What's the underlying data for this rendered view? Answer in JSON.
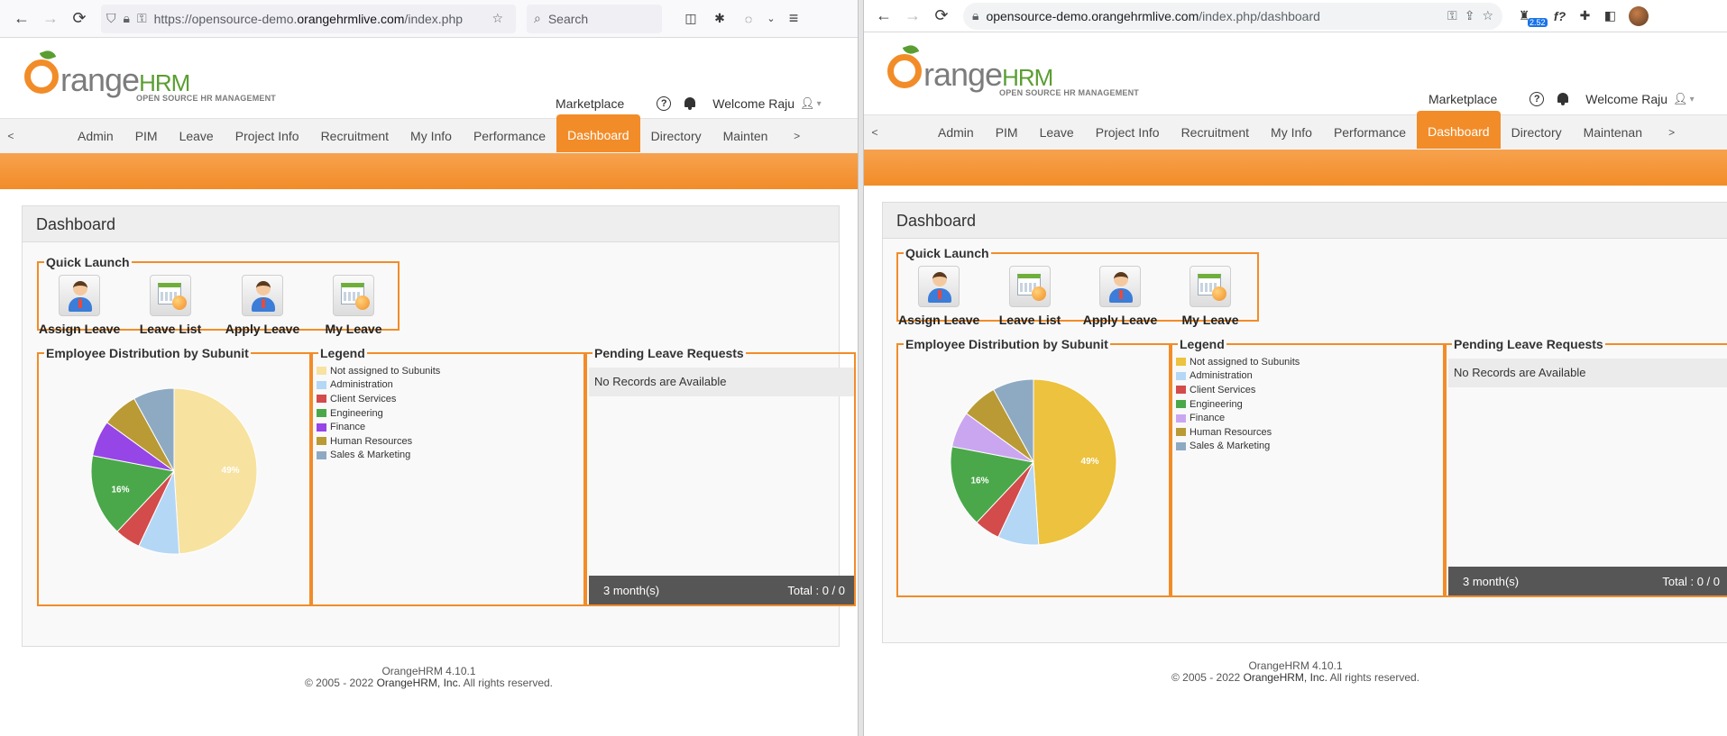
{
  "left_browser": {
    "url_prefix": "https://opensource-demo.",
    "url_host": "orangehrmlive.com",
    "url_suffix": "/index.php",
    "search_placeholder": "Search"
  },
  "right_browser": {
    "url_host": "opensource-demo.orangehrmlive.com",
    "url_path": "/index.php/dashboard",
    "extension_badge": "2.52",
    "formula_label": "f?"
  },
  "brand": {
    "logo_word": "range",
    "logo_hrm": "HRM",
    "tagline": "OPEN SOURCE HR MANAGEMENT",
    "orange": "#f28c28",
    "green": "#5a9e32"
  },
  "header": {
    "marketplace": "Marketplace",
    "help": "?",
    "welcome": "Welcome Raju"
  },
  "nav": {
    "prev": "<",
    "next": ">",
    "items": [
      "Admin",
      "PIM",
      "Leave",
      "Project Info",
      "Recruitment",
      "My Info",
      "Performance",
      "Dashboard",
      "Directory"
    ],
    "last_item_left": "Mainten",
    "last_item_right": "Maintenan",
    "active": "Dashboard"
  },
  "dashboard": {
    "title": "Dashboard",
    "quick_launch": {
      "legend": "Quick Launch",
      "items": [
        "Assign Leave",
        "Leave List",
        "Apply Leave",
        "My Leave"
      ]
    },
    "distribution_title": "Employee Distribution by Subunit",
    "legend_title": "Legend",
    "pending_title": "Pending Leave Requests",
    "pending_empty": "No Records are Available",
    "pending_period": "3 month(s)",
    "pending_total": "Total : 0 / 0"
  },
  "chart_data": [
    {
      "type": "pie",
      "title": "Employee Distribution by Subunit",
      "series": [
        {
          "name": "Not assigned to Subunits",
          "value": 49,
          "label": "49%",
          "color": "#f7e2a0"
        },
        {
          "name": "Administration",
          "value": 8,
          "label": "",
          "color": "#b4d7f5"
        },
        {
          "name": "Client Services",
          "value": 5,
          "label": "",
          "color": "#d34b4b"
        },
        {
          "name": "Engineering",
          "value": 16,
          "label": "16%",
          "color": "#4aa84a"
        },
        {
          "name": "Finance",
          "value": 7,
          "label": "",
          "color": "#9645e6"
        },
        {
          "name": "Human Resources",
          "value": 7,
          "label": "",
          "color": "#b99a34"
        },
        {
          "name": "Sales & Marketing",
          "value": 8,
          "label": "",
          "color": "#8eaac3"
        }
      ]
    },
    {
      "type": "pie",
      "title": "Employee Distribution by Subunit",
      "series": [
        {
          "name": "Not assigned to Subunits",
          "value": 49,
          "label": "49%",
          "color": "#ecc23e"
        },
        {
          "name": "Administration",
          "value": 8,
          "label": "",
          "color": "#b4d7f5"
        },
        {
          "name": "Client Services",
          "value": 5,
          "label": "",
          "color": "#d34b4b"
        },
        {
          "name": "Engineering",
          "value": 16,
          "label": "16%",
          "color": "#4aa84a"
        },
        {
          "name": "Finance",
          "value": 7,
          "label": "",
          "color": "#caa6f0"
        },
        {
          "name": "Human Resources",
          "value": 7,
          "label": "",
          "color": "#b99a34"
        },
        {
          "name": "Sales & Marketing",
          "value": 8,
          "label": "",
          "color": "#8eaac3"
        }
      ]
    }
  ],
  "footer": {
    "version": "OrangeHRM 4.10.1",
    "copy_prefix": "© 2005 - 2022 ",
    "company": "OrangeHRM, Inc.",
    "copy_suffix": " All rights reserved."
  }
}
